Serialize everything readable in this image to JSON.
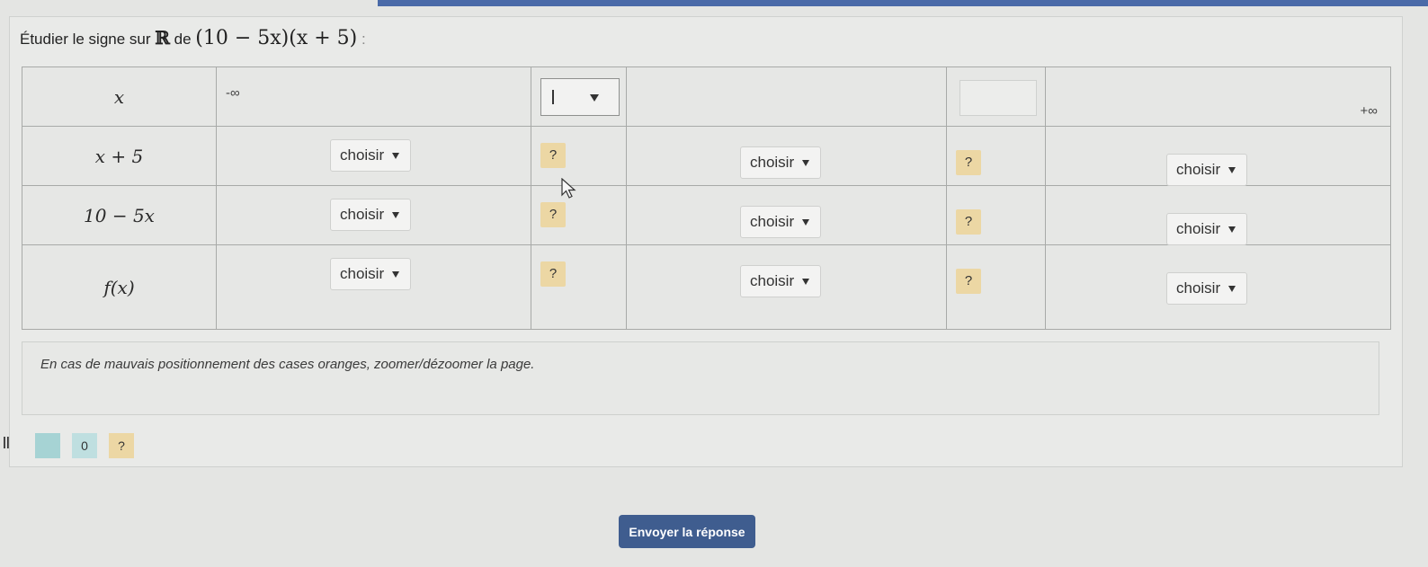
{
  "question": {
    "prefix": "Étudier le signe sur",
    "set_symbol": "ℝ",
    "middle": "de",
    "expression": "(10 − 5x)(x + 5)",
    "suffix": ":"
  },
  "table": {
    "x_label": "x",
    "minus_inf": "-∞",
    "plus_inf": "+∞",
    "rows": [
      {
        "label": "x + 5"
      },
      {
        "label": "10 − 5x"
      },
      {
        "label": "f(x)"
      }
    ],
    "select_label": "choisir",
    "question_mark": "?"
  },
  "note": "En cas de mauvais positionnement des cases oranges, zoomer/dézoomer la page.",
  "legend": {
    "pause": "||",
    "zero": "0",
    "question": "?"
  },
  "submit_label": "Envoyer la réponse",
  "colors": {
    "accent": "#3f5d8f",
    "orange_box": "#ecd7a4",
    "teal_box": "#a6d3d4"
  }
}
